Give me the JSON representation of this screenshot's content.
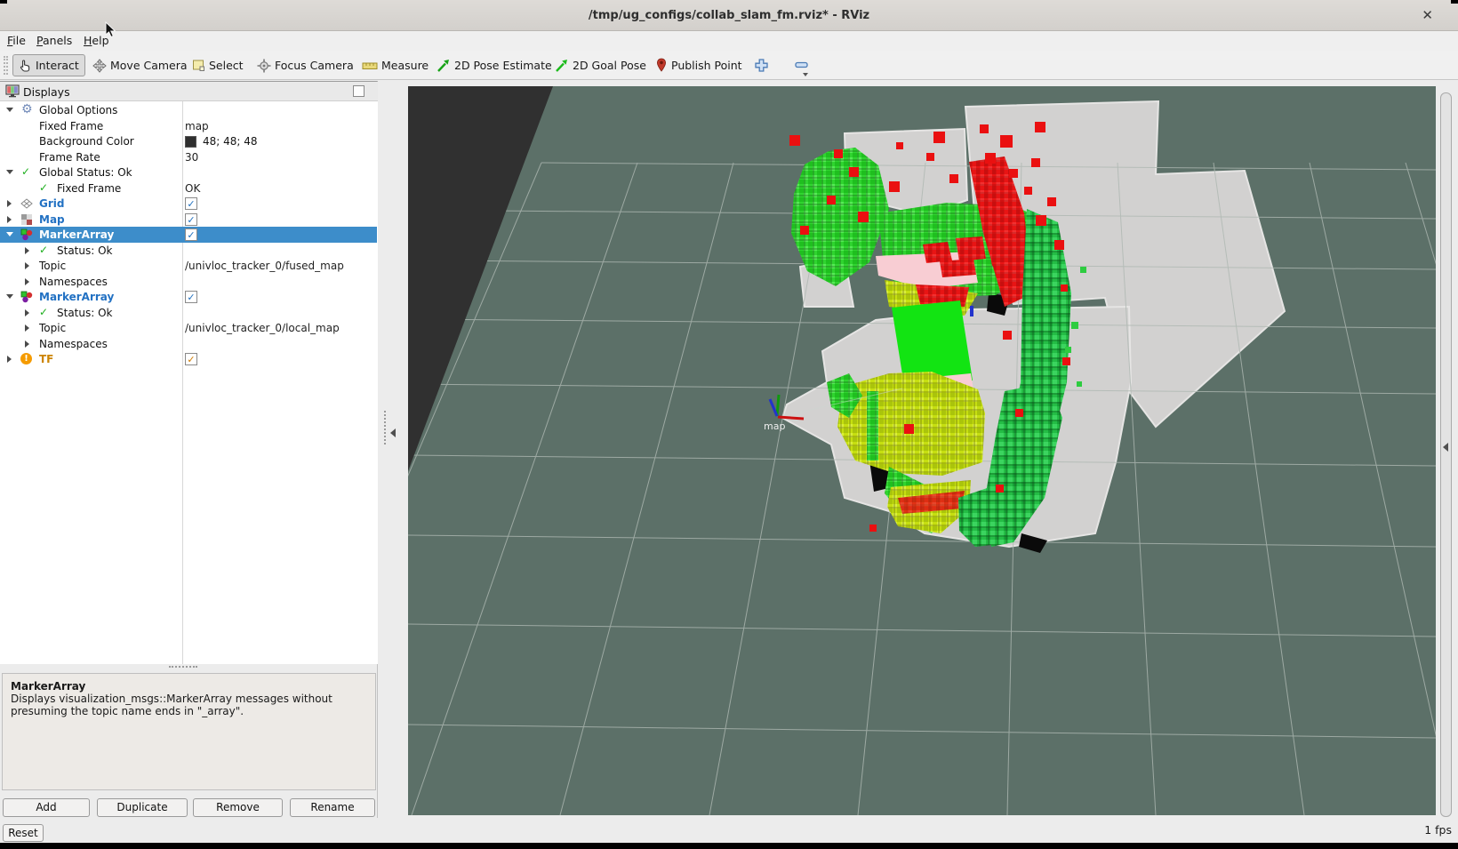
{
  "window": {
    "title": "/tmp/ug_configs/collab_slam_fm.rviz* - RViz",
    "close_glyph": "✕"
  },
  "menu": {
    "items": [
      {
        "first": "F",
        "rest": "ile"
      },
      {
        "first": "P",
        "rest": "anels"
      },
      {
        "first": "H",
        "rest": "elp"
      }
    ]
  },
  "toolbar": {
    "buttons": [
      {
        "label": "Interact",
        "icon": "hand-cursor-icon",
        "active": true
      },
      {
        "label": "Move Camera",
        "icon": "move-arrows-icon"
      },
      {
        "label": "Select",
        "icon": "selection-box-icon"
      },
      {
        "label": "Focus Camera",
        "icon": "crosshair-icon"
      },
      {
        "label": "Measure",
        "icon": "ruler-icon"
      },
      {
        "label": "2D Pose Estimate",
        "icon": "green-arrow-icon"
      },
      {
        "label": "2D Goal Pose",
        "icon": "green-arrow-icon"
      },
      {
        "label": "Publish Point",
        "icon": "map-pin-icon"
      },
      {
        "label": "",
        "icon": "add-tool-icon"
      },
      {
        "label": "",
        "icon": "remove-tool-icon"
      }
    ]
  },
  "displays": {
    "title": "Displays",
    "ok_glyph": "✓",
    "rows": [
      {
        "label": "Global Options"
      },
      {
        "label": "Fixed Frame",
        "value": "map"
      },
      {
        "label": "Background Color",
        "value": "48; 48; 48"
      },
      {
        "label": "Frame Rate",
        "value": "30"
      },
      {
        "label": "Global Status: Ok"
      },
      {
        "label": "Fixed Frame",
        "value": "OK"
      },
      {
        "label": "Grid",
        "checked": true
      },
      {
        "label": "Map",
        "checked": true
      },
      {
        "label": "MarkerArray",
        "checked": true,
        "selected": true
      },
      {
        "label": "Status: Ok"
      },
      {
        "label": "Topic",
        "value": "/univloc_tracker_0/fused_map"
      },
      {
        "label": "Namespaces"
      },
      {
        "label": "MarkerArray",
        "checked": true
      },
      {
        "label": "Status: Ok"
      },
      {
        "label": "Topic",
        "value": "/univloc_tracker_0/local_map"
      },
      {
        "label": "Namespaces"
      },
      {
        "label": "TF",
        "checked": true,
        "warning": true
      }
    ],
    "description_title": "MarkerArray",
    "description_body": "Displays visualization_msgs::MarkerArray messages without presuming the topic name ends in \"_array\".",
    "buttons": [
      {
        "label": "Add"
      },
      {
        "label": "Duplicate"
      },
      {
        "label": "Remove"
      },
      {
        "label": "Rename"
      }
    ]
  },
  "viewport": {
    "frame_label": "map"
  },
  "statusbar": {
    "reset_label": "Reset",
    "fps_label": "1 fps"
  },
  "colors": {
    "selection_blue": "#3d8dca",
    "display_name_blue": "#2271c3",
    "tf_warn_orange": "#f59b00",
    "status_ok_green": "#1faf1f",
    "viewport_background": "#5c7068",
    "void_background": "#303030",
    "map_gray": "#d2d1d0",
    "marker_green": "#2fd42f",
    "marker_yellow_green": "#c6df10",
    "marker_red": "#e81414",
    "marker_pink": "#f8cdd3",
    "marker_bright_green": "#12e412"
  }
}
